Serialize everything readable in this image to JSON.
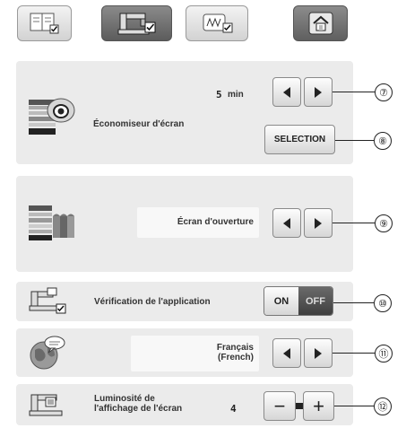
{
  "tabs": [
    {
      "name": "settings-tab-general",
      "icon": "book-check-icon",
      "active": false
    },
    {
      "name": "settings-tab-machine",
      "icon": "machine-check-icon",
      "active": true
    },
    {
      "name": "settings-tab-embroidery",
      "icon": "embroidery-check-icon",
      "active": false
    }
  ],
  "home_icon": "home-icon",
  "screen_saver": {
    "label": "Économiseur d'écran",
    "time_value": "5",
    "time_unit": "min",
    "selection_label": "SELECTION",
    "callout_time": "⑦",
    "callout_selection": "⑧"
  },
  "opening_screen": {
    "label": "Écran d'ouverture",
    "callout": "⑨"
  },
  "app_check": {
    "label": "Vérification de l'application",
    "on_label": "ON",
    "off_label": "OFF",
    "selected": "OFF",
    "callout": "⑩"
  },
  "language": {
    "line1": "Français",
    "line2": "(French)",
    "callout": "⑪"
  },
  "brightness": {
    "label_line1": "Luminosité de",
    "label_line2": "l'affichage de l'écran",
    "value": "4",
    "minus": "−",
    "plus": "+",
    "callout": "⑫"
  },
  "colors": {
    "panel_bg": "#ebebeb",
    "active_tab": "#6e6e6e",
    "off_active": "#5a5a5a"
  }
}
